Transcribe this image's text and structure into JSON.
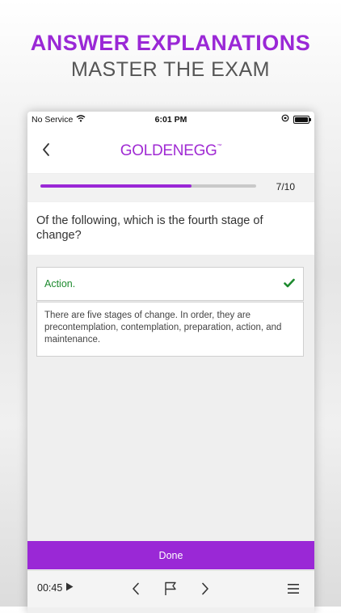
{
  "hero": {
    "title": "ANSWER EXPLANATIONS",
    "subtitle": "MASTER THE EXAM"
  },
  "status_bar": {
    "carrier": "No Service",
    "time": "6:01 PM"
  },
  "header": {
    "logo_text": "GOLDENEGG",
    "logo_tm": "™",
    "back_icon": "chevron-left-icon"
  },
  "progress": {
    "label": "7/10",
    "fraction": 0.7
  },
  "question": {
    "text": "Of the following, which is the fourth stage of change?"
  },
  "answer": {
    "text": "Action.",
    "status_icon": "check-icon",
    "color": "#1d8a2e"
  },
  "explanation": {
    "text": "There are five stages of change. In order, they are precontemplation, contemplation, preparation, action, and maintenance."
  },
  "done_button": {
    "label": "Done"
  },
  "toolbar": {
    "timer": "00:45"
  },
  "colors": {
    "accent": "#9a28d6",
    "correct": "#1d8a2e"
  }
}
